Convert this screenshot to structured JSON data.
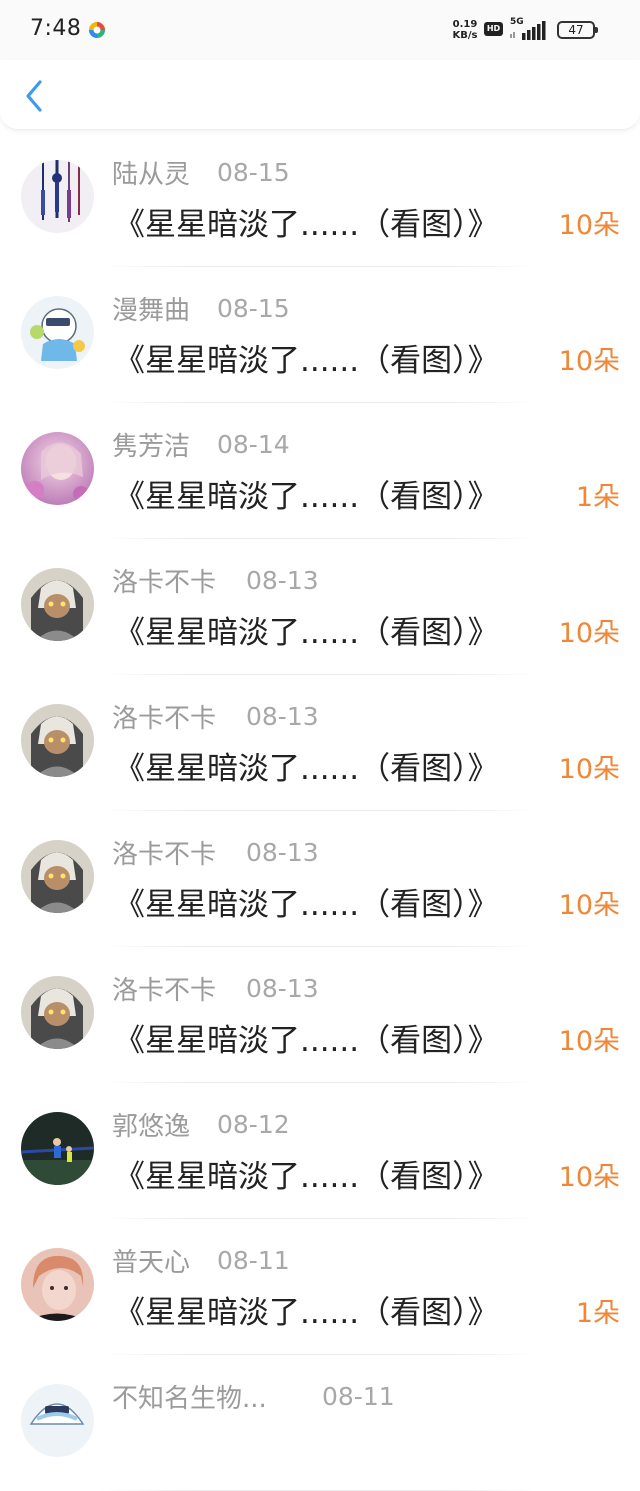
{
  "status_bar": {
    "time": "7:48",
    "net_speed_value": "0.19",
    "net_speed_unit": "KB/s",
    "hd_label": "HD",
    "network_type": "5G",
    "battery": "47"
  },
  "nav": {
    "back_icon": "chevron-left-icon",
    "accent_color": "#3a9bf0"
  },
  "colors": {
    "count": "#f08636",
    "name": "#9b9b9b",
    "title": "#222222"
  },
  "records": [
    {
      "name": "陆从灵",
      "date": "08-15",
      "title": "《星星暗淡了......（看图）》",
      "count": "10朵"
    },
    {
      "name": "漫舞曲",
      "date": "08-15",
      "title": "《星星暗淡了......（看图）》",
      "count": "10朵"
    },
    {
      "name": "隽芳洁",
      "date": "08-14",
      "title": "《星星暗淡了......（看图）》",
      "count": "1朵"
    },
    {
      "name": "洛卡不卡",
      "date": "08-13",
      "title": "《星星暗淡了......（看图）》",
      "count": "10朵"
    },
    {
      "name": "洛卡不卡",
      "date": "08-13",
      "title": "《星星暗淡了......（看图）》",
      "count": "10朵"
    },
    {
      "name": "洛卡不卡",
      "date": "08-13",
      "title": "《星星暗淡了......（看图）》",
      "count": "10朵"
    },
    {
      "name": "洛卡不卡",
      "date": "08-13",
      "title": "《星星暗淡了......（看图）》",
      "count": "10朵"
    },
    {
      "name": "郭悠逸",
      "date": "08-12",
      "title": "《星星暗淡了......（看图）》",
      "count": "10朵"
    },
    {
      "name": "普天心",
      "date": "08-11",
      "title": "《星星暗淡了......（看图）》",
      "count": "1朵"
    },
    {
      "name": "不知名生物...",
      "date": "08-11",
      "title": "",
      "count": ""
    }
  ]
}
